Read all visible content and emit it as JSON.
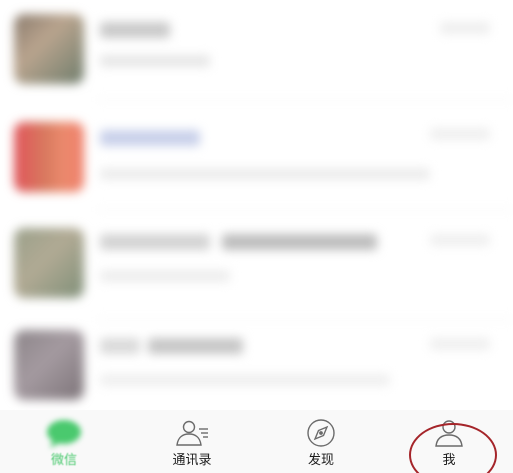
{
  "tabbar": {
    "tabs": [
      {
        "label": "微信",
        "icon": "chat-bubble-icon",
        "active": true
      },
      {
        "label": "通讯录",
        "icon": "contacts-icon",
        "active": false
      },
      {
        "label": "发现",
        "icon": "compass-icon",
        "active": false
      },
      {
        "label": "我",
        "icon": "person-icon",
        "active": false
      }
    ]
  },
  "colors": {
    "accent": "#4ac96e",
    "highlight_circle": "#a5252a",
    "tabbar_bg": "#f9f9f9"
  }
}
